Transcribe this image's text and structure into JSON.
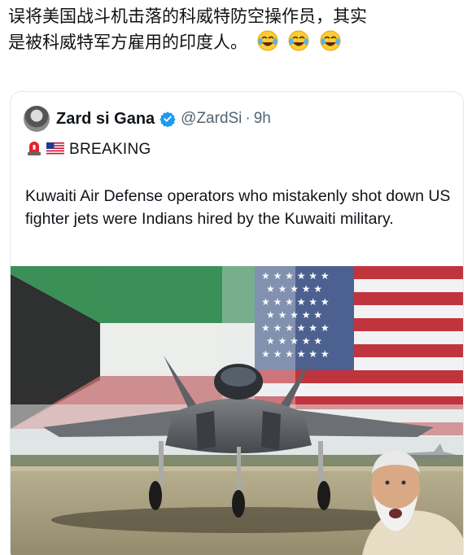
{
  "post": {
    "line1": "误将美国战斗机击落的科威特防空操作员，其实",
    "line2": "是被科威特军方雇用的印度人。",
    "emojis": [
      "laughing-with-tears-emoji",
      "laughing-with-tears-emoji",
      "laughing-with-tears-emoji"
    ]
  },
  "quoted_tweet": {
    "display_name": "Zard si Gana",
    "handle": "@ZardSi",
    "separator": "·",
    "time": "9h",
    "verified": true,
    "breaking_label": "BREAKING",
    "body": "Kuwaiti Air Defense operators who mistakenly shot down US fighter jets were Indians hired by the Kuwaiti military.",
    "icons": [
      "siren-emoji",
      "us-flag-emoji"
    ]
  },
  "media": {
    "description_icons": [
      "kuwait-flag",
      "us-flag",
      "fighter-jet",
      "man-portrait"
    ]
  },
  "colors": {
    "verified_blue": "#1d9bf0",
    "secondary_text": "#536471",
    "primary_text": "#0f1419"
  }
}
